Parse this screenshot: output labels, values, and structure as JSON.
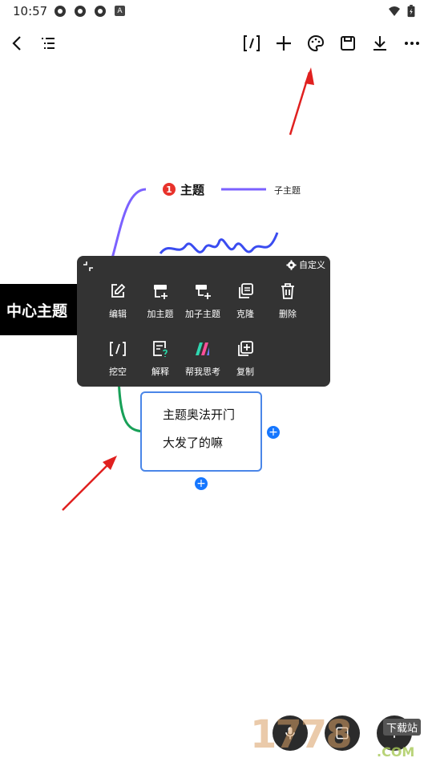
{
  "status_bar": {
    "time": "10:57",
    "icons": [
      "app-notification-icon",
      "app-notification-icon",
      "app-notification-icon",
      "a-badge-icon",
      "wifi-icon",
      "battery-icon"
    ],
    "badge_letter": "A"
  },
  "toolbar": {
    "left": [
      "back-icon",
      "outline-list-icon"
    ],
    "right": [
      "blank-fill-icon",
      "add-icon",
      "palette-icon",
      "save-icon",
      "download-icon",
      "more-icon"
    ]
  },
  "canvas": {
    "central_topic": "中心主题",
    "main_topic": {
      "badge": "1",
      "label": "主题"
    },
    "subtopic": "子主题",
    "selected_node": {
      "line1": "主题奥法开门",
      "line2": "大发了的嘛"
    },
    "add_symbol": "+"
  },
  "context_menu": {
    "customize_label": "自定义",
    "items_row1": [
      {
        "icon": "edit-icon",
        "label": "编辑"
      },
      {
        "icon": "add-topic-icon",
        "label": "加主题"
      },
      {
        "icon": "add-subtopic-icon",
        "label": "加子主题"
      },
      {
        "icon": "clone-icon",
        "label": "克隆"
      },
      {
        "icon": "delete-icon",
        "label": "删除"
      }
    ],
    "items_row2": [
      {
        "icon": "blank-fill-icon",
        "label": "挖空"
      },
      {
        "icon": "explain-icon",
        "label": "解释"
      },
      {
        "icon": "ai-think-icon",
        "label": "帮我思考"
      },
      {
        "icon": "copy-icon",
        "label": "复制"
      }
    ]
  },
  "colors": {
    "menu_bg": "#333333",
    "central_bg": "#000000",
    "main_branch": "#7b61ff",
    "green_branch": "#18a058",
    "selection": "#4a86e8",
    "add_button": "#1677ff",
    "badge": "#e8322b",
    "annotation_arrow": "#e0201f",
    "scribble": "#3a4cf0"
  },
  "watermark": {
    "text": "1778",
    "sub": "下载站",
    "domain": ".COM"
  }
}
